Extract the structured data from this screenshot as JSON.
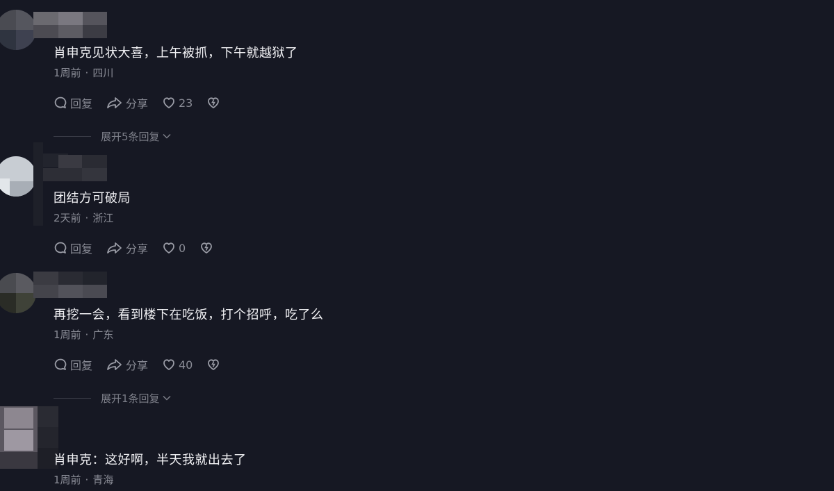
{
  "comments": [
    {
      "text": "肖申克见状大喜，上午被抓，下午就越狱了",
      "time": "1周前",
      "location": "四川",
      "reply_label": "回复",
      "share_label": "分享",
      "likes": "23",
      "expand_label": "展开5条回复"
    },
    {
      "text": "团结方可破局",
      "time": "2天前",
      "location": "浙江",
      "reply_label": "回复",
      "share_label": "分享",
      "likes": "0"
    },
    {
      "text": "再挖一会，看到楼下在吃饭，打个招呼，吃了么",
      "time": "1周前",
      "location": "广东",
      "reply_label": "回复",
      "share_label": "分享",
      "likes": "40",
      "expand_label": "展开1条回复"
    },
    {
      "text": "肖申克：这好啊，半天我就出去了",
      "time": "1周前",
      "location": "青海"
    }
  ],
  "separator": "·",
  "icons": {
    "reply": "comment-bubble-icon",
    "share": "share-arrow-icon",
    "like": "heart-icon",
    "dislike": "broken-heart-icon",
    "expand": "chevron-down-icon"
  },
  "colors": {
    "background": "#161823",
    "text": "#f1f1f4",
    "secondary": "#8a8c96"
  }
}
